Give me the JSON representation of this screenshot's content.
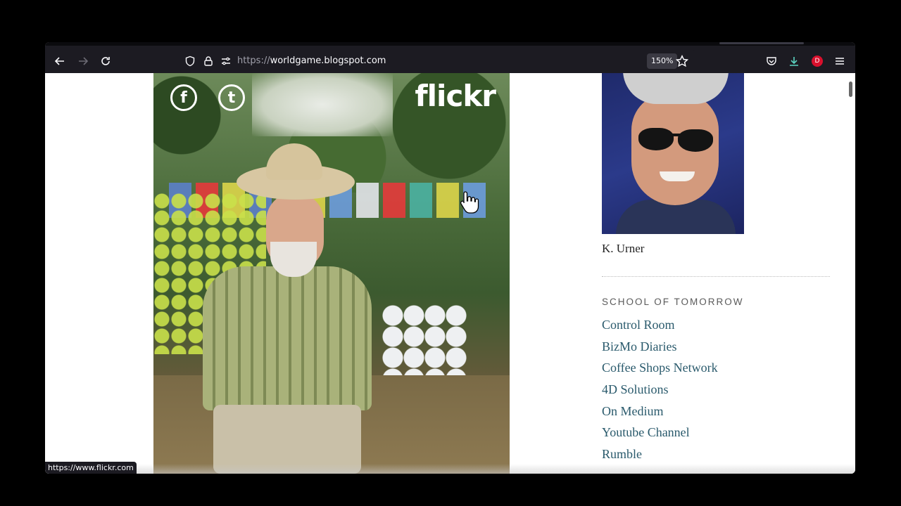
{
  "browser": {
    "url_scheme": "https://",
    "url_host": "worldgame.blogspot.com",
    "zoom": "150%",
    "status_url": "https://www.flickr.com",
    "accent_download": "#5bd4c2",
    "profile_color": "#d9102d",
    "profile_initial": "D"
  },
  "photo": {
    "brand": "flickr",
    "social_icons": [
      "facebook-icon",
      "tumblr-icon"
    ]
  },
  "sidebar": {
    "author_name": "K. Urner",
    "section_title": "SCHOOL OF TOMORROW",
    "links": [
      "Control Room",
      "BizMo Diaries",
      "Coffee Shops Network",
      "4D Solutions",
      "On Medium",
      "Youtube Channel",
      "Rumble"
    ],
    "link_color": "#2a5a6c"
  }
}
